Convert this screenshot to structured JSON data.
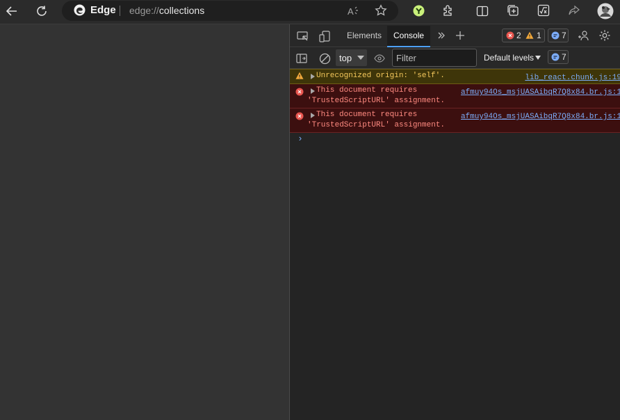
{
  "browser": {
    "brand": "Edge",
    "url_scheme": "edge://",
    "url_path": "collections",
    "icons": [
      "back-arrow-icon",
      "refresh-icon",
      "edge-logo-icon",
      "read-aloud-icon",
      "favorite-star-icon",
      "extension-shield-icon",
      "extensions-puzzle-icon",
      "split-screen-icon",
      "collections-icon",
      "math-solver-icon",
      "share-icon",
      "profile-avatar-icon"
    ]
  },
  "devtools": {
    "tabs": [
      {
        "label": "Elements"
      },
      {
        "label": "Console"
      }
    ],
    "counts": {
      "errors": "2",
      "warnings": "1",
      "messages": "7"
    },
    "toolbar": {
      "context": "top",
      "filter_placeholder": "Filter",
      "levels": "Default levels",
      "messages_count": "7"
    },
    "messages": [
      {
        "level": "warning",
        "text": "Unrecognized origin: 'self'.",
        "source": "lib_react.chunk.js:19"
      },
      {
        "level": "error",
        "text": "This document requires",
        "text_line2": "'TrustedScriptURL' assignment.",
        "source": "afmuy94Os_msjUASAibqR7Q8x84.br.js:1"
      },
      {
        "level": "error",
        "text": "This document requires",
        "text_line2": "'TrustedScriptURL' assignment.",
        "source": "afmuy94Os_msjUASAibqR7Q8x84.br.js:1"
      }
    ],
    "prompt": "›"
  }
}
